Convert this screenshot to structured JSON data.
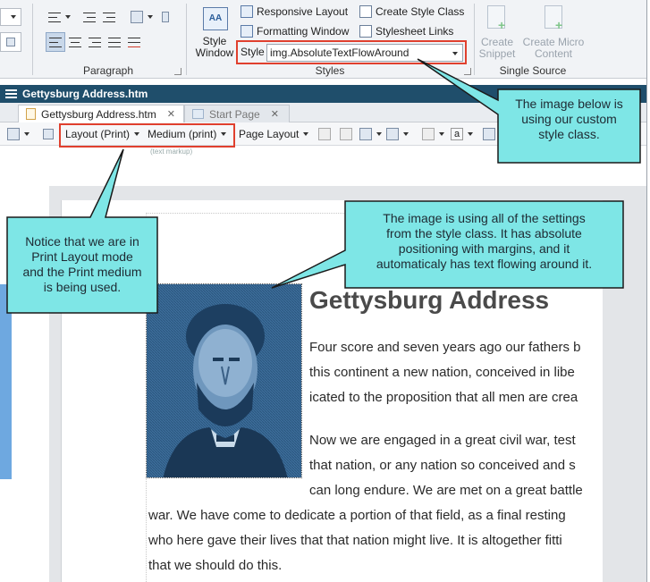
{
  "ribbon": {
    "groups": {
      "paragraph": "Paragraph",
      "styles": "Styles",
      "single_source": "Single Source"
    },
    "style_window_label": "Style\nWindow",
    "style_window_line1": "Style",
    "style_window_line2": "Window",
    "responsive_layout": "Responsive Layout",
    "formatting_window": "Formatting Window",
    "create_style_class": "Create Style Class",
    "stylesheet_links": "Stylesheet Links",
    "style_label": "Style",
    "style_value": "img.AbsoluteTextFlowAround",
    "create_snippet_line1": "Create",
    "create_snippet_line2": "Snippet",
    "create_micro_line1": "Create Micro",
    "create_micro_line2": "Content"
  },
  "titlebar": {
    "title": "Gettysburg Address.htm"
  },
  "tabs": [
    {
      "label": "Gettysburg Address.htm",
      "close": "✕"
    },
    {
      "label": "Start Page",
      "close": "✕"
    }
  ],
  "editor_toolbar": {
    "layout": "Layout (Print)",
    "medium": "Medium (print)",
    "page_layout": "Page Layout",
    "hint": "(text markup)",
    "a_glyph": "a"
  },
  "document": {
    "title": "Gettysburg Address",
    "lines": [
      "Four score and seven years ago our fathers b",
      "this continent a new nation, conceived in libe",
      "icated to the proposition that all men are crea",
      "Now we are engaged in a great civil war, test",
      "that nation, or any nation so conceived and s",
      "can long endure. We are met on a great battle",
      "war. We have come to dedicate a portion of that field, as a final resting",
      "who here gave their lives that that nation might live. It is altogether fitti",
      "that we should do this."
    ]
  },
  "callouts": {
    "style_class": [
      "The image below is",
      "using our custom",
      "style class."
    ],
    "settings": [
      "The image is using all of the settings",
      "from the style class. It has absolute",
      "positioning with margins, and it",
      "automaticaly has text flowing around it."
    ],
    "print_layout": [
      "Notice that we are in",
      "Print Layout mode",
      "and the Print medium",
      "is being used."
    ]
  },
  "colors": {
    "callout_fill": "#7ee6e6",
    "highlight_red": "#e0402e",
    "titlebar": "#1f4e6b",
    "portrait_blue": "#2f5f8c"
  },
  "icons": [
    "bullet-list-icon",
    "indent-icon",
    "outdent-icon",
    "align-left-icon",
    "align-center-icon",
    "align-right-icon",
    "justify-icon",
    "clear-format-icon",
    "style-window-icon",
    "responsive-layout-icon",
    "formatting-window-icon",
    "create-style-class-icon",
    "stylesheet-links-icon",
    "create-snippet-icon",
    "create-micro-content-icon",
    "hamburger-icon",
    "document-icon",
    "start-page-icon",
    "zoom-icon"
  ]
}
